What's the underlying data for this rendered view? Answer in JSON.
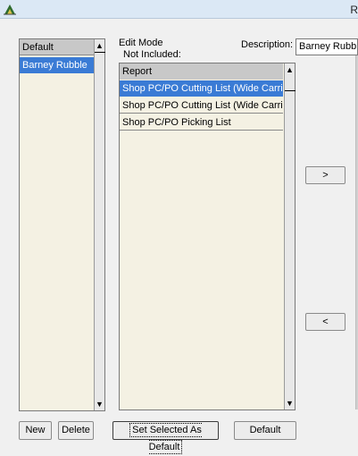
{
  "window": {
    "title_fragment": "R"
  },
  "profiles": {
    "header": "Default",
    "items": [
      "Barney Rubble"
    ],
    "selected_index": 0
  },
  "edit_mode": {
    "label": "Edit Mode",
    "not_included_label": "Not Included:",
    "column_header": "Report",
    "reports": [
      "Shop PC/PO Cutting List (Wide Carriage)",
      "Shop PC/PO Cutting List (Wide Carriage)",
      "Shop PC/PO Picking List"
    ],
    "selected_index": 0
  },
  "description": {
    "label": "Description:",
    "value": "Barney Rubble"
  },
  "transfer": {
    "add_label": ">",
    "remove_label": "<"
  },
  "buttons": {
    "new": "New",
    "delete": "Delete",
    "set_default": "Set Selected As Default",
    "default": "Default"
  },
  "colors": {
    "selection": "#3a7bd5",
    "list_background": "#f4f1e3",
    "titlebar": "#dbe8f5"
  }
}
